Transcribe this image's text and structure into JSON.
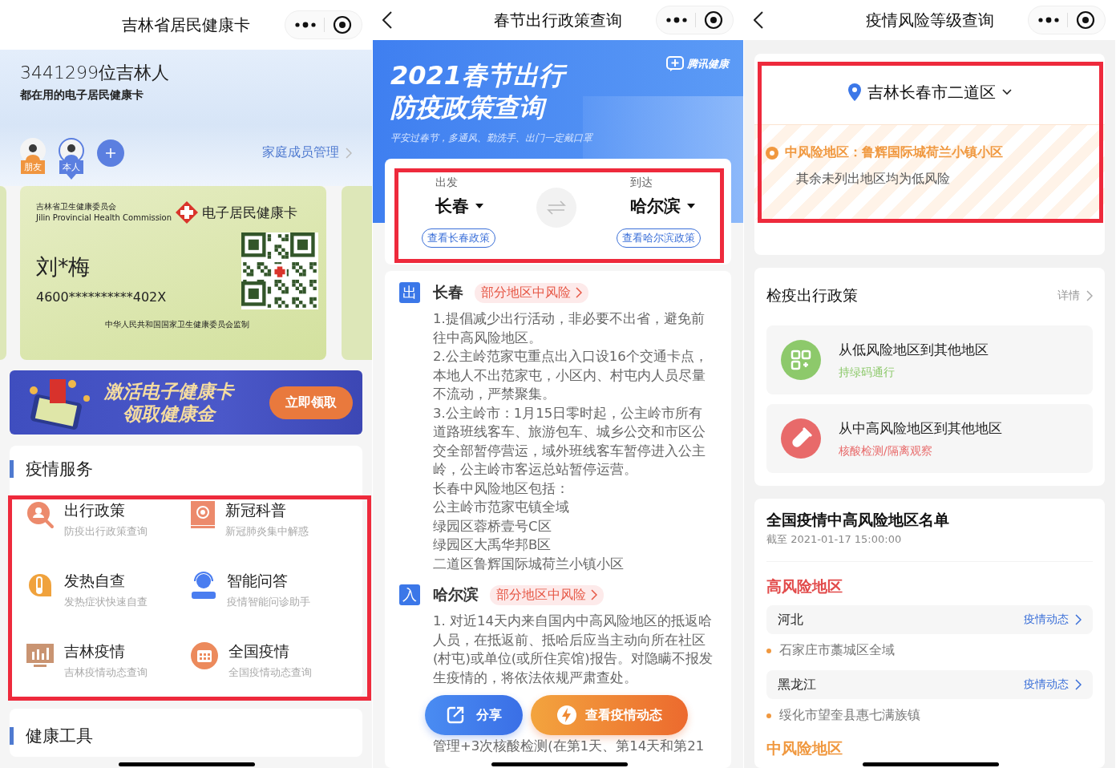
{
  "health_card_screen": {
    "title": "吉林省居民健康卡",
    "header": {
      "headline": "3441299位吉林人",
      "subline": "都在用的电子居民健康卡"
    },
    "members": [
      {
        "tag": "朋友",
        "color": "#f0953f",
        "selected": false
      },
      {
        "tag": "本人",
        "color": "#5b7fe0",
        "selected": true
      }
    ],
    "family_link": "家庭成员管理",
    "card": {
      "issuer": "吉林省卫生健康委员会",
      "issuer_en": "Jilin Provincial Health Commission",
      "card_name": "电子居民健康卡",
      "holder": "刘*梅",
      "id_number": "4600**********402X",
      "footer": "中华人民共和国国家卫生健康委员会监制"
    },
    "banner": {
      "line1": "激活电子健康卡",
      "line2": "领取健康金",
      "button": "立即领取"
    },
    "services": {
      "heading": "疫情服务",
      "items": [
        {
          "kind": "travel",
          "title": "出行政策",
          "subtitle": "防疫出行政策查询"
        },
        {
          "kind": "science",
          "title": "新冠科普",
          "subtitle": "新冠肺炎集中解惑"
        },
        {
          "kind": "fever",
          "title": "发热自查",
          "subtitle": "发热症状快速自查"
        },
        {
          "kind": "assistant",
          "title": "智能问答",
          "subtitle": "疫情智能问诊助手"
        },
        {
          "kind": "local",
          "title": "吉林疫情",
          "subtitle": "吉林疫情动态查询"
        },
        {
          "kind": "national",
          "title": "全国疫情",
          "subtitle": "全国疫情动态查询"
        }
      ]
    },
    "tools": {
      "heading": "健康工具"
    }
  },
  "travel_policy_screen": {
    "title": "春节出行政策查询",
    "hero": {
      "line1": "2021春节出行",
      "line2": "防疫政策查询",
      "tagline": "平安过春节，多通风、勤洗手、出门一定戴口罩",
      "brand": "腾讯健康"
    },
    "route": {
      "from_label": "出发",
      "from": "长春",
      "to_label": "到达",
      "to": "哈尔滨",
      "from_button": "查看长春政策",
      "to_button": "查看哈尔滨政策"
    },
    "cities": [
      {
        "badge": "出",
        "name": "长春",
        "risk_tag": "部分地区中风险",
        "paragraphs": [
          "1.提倡减少出行活动，非必要不出省，避免前往中高风险地区。",
          "2.公主岭范家屯重点出入口设16个交通卡点，本地人不出范家屯，小区内、村屯内人员尽量不流动，严禁聚集。",
          "3.公主岭市：1月15日零时起，公主岭市所有道路班线客车、旅游包车、城乡公交和市区公交全部暂停营运，域外班线客车暂停进入公主岭，公主岭市客运总站暂停运营。",
          "长春中风险地区包括：",
          "公主岭市范家屯镇全域",
          "绿园区蓉桥壹号C区",
          "绿园区大禹华邦B区",
          "二道区鲁辉国际城荷兰小镇小区"
        ]
      },
      {
        "badge": "入",
        "name": "哈尔滨",
        "risk_tag": "部分地区中风险",
        "paragraphs": [
          "1. 对近14天内来自国内中高风险地区的抵返哈人员，在抵返前、抵哈后应当主动向所在社区(村屯)或单位(或所住宾馆)报告。对隐瞒不报发生疫情的，将依法依规严肃查处。"
        ]
      }
    ],
    "actions": {
      "share": "分享",
      "dynamics": "查看疫情动态"
    },
    "trailing_line": "管理+3次核酸检测(在第1天、第14天和第21"
  },
  "risk_level_screen": {
    "title": "疫情风险等级查询",
    "location": "吉林长春市二道区",
    "alert": {
      "text": "中风险地区：鲁辉国际城荷兰小镇小区",
      "note": "其余未列出地区均为低风险"
    },
    "policy": {
      "heading": "检疫出行政策",
      "more": "详情",
      "items": [
        {
          "kind": "low",
          "title": "从低风险地区到其他地区",
          "subtitle": "持绿码通行"
        },
        {
          "kind": "high",
          "title": "从中高风险地区到其他地区",
          "subtitle": "核酸检测/隔离观察"
        }
      ]
    },
    "list": {
      "heading": "全国疫情中高风险地区名单",
      "updated": "截至 2021-01-17 15:00:00",
      "groups": [
        {
          "kind": "high",
          "heading": "高风险地区",
          "provinces": [
            {
              "name": "河北",
              "link": "疫情动态",
              "areas": [
                "石家庄市藁城区全域"
              ]
            },
            {
              "name": "黑龙江",
              "link": "疫情动态",
              "areas": [
                "绥化市望奎县惠七满族镇"
              ]
            }
          ]
        },
        {
          "kind": "medium",
          "heading": "中风险地区"
        }
      ]
    }
  }
}
